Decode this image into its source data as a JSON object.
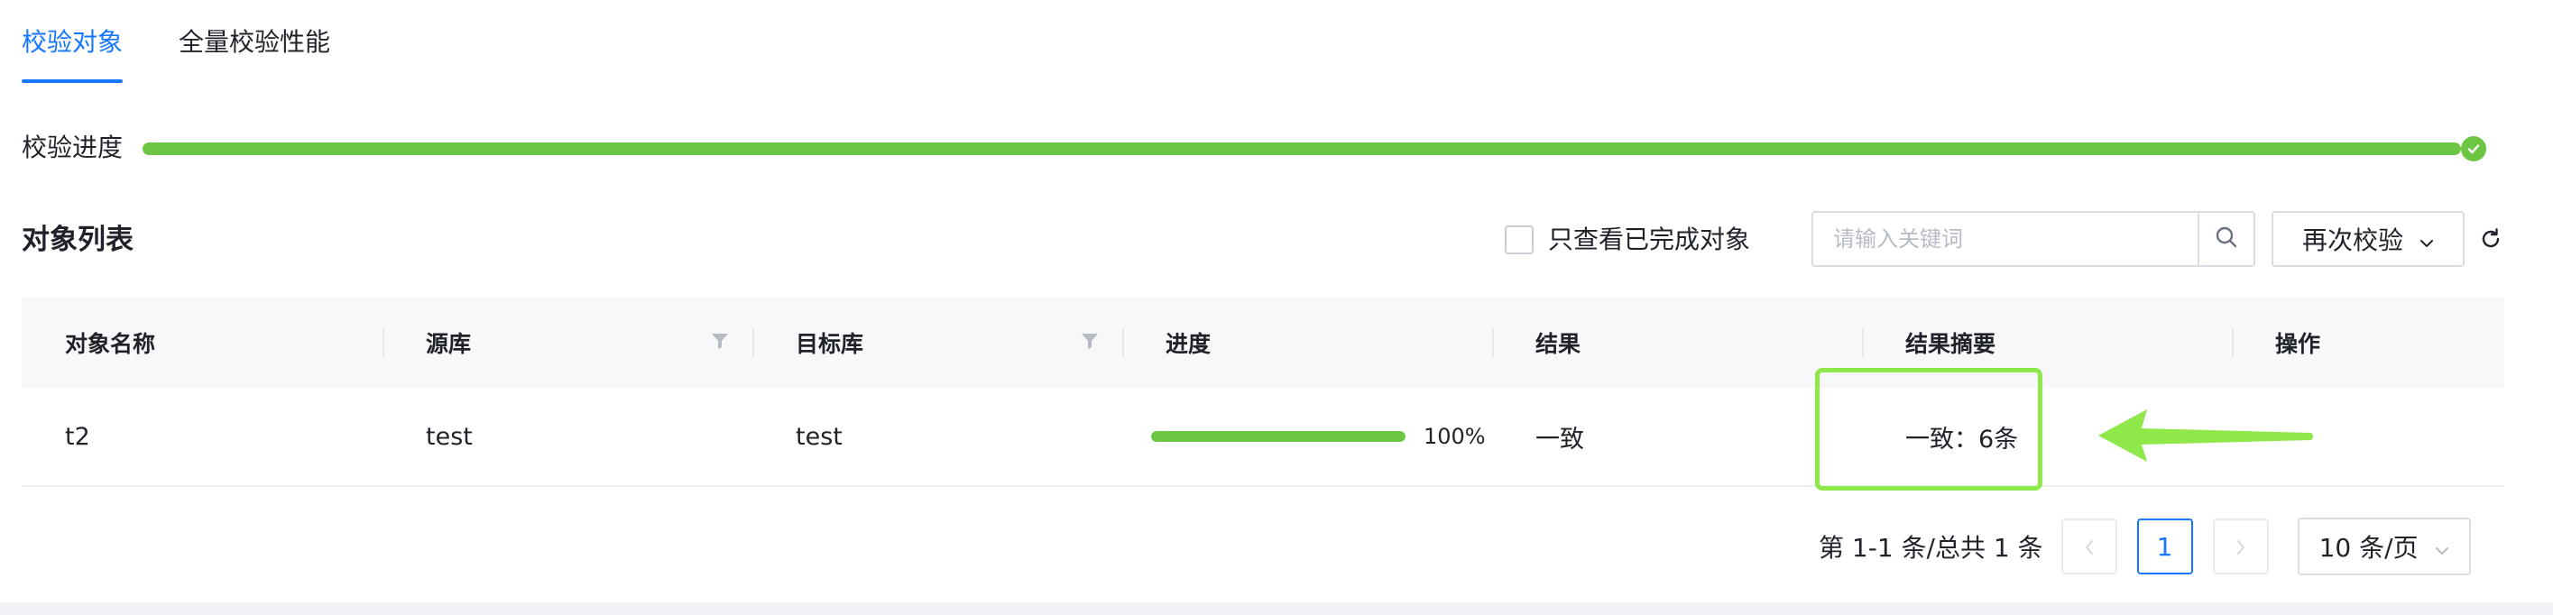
{
  "tabs": [
    {
      "label": "校验对象",
      "active": true
    },
    {
      "label": "全量校验性能",
      "active": false
    }
  ],
  "overall_progress": {
    "label": "校验进度",
    "value": 1.0,
    "status": "complete"
  },
  "list": {
    "title": "对象列表",
    "filter_checkbox_label": "只查看已完成对象",
    "filter_checked": false,
    "search_placeholder": "请输入关键词",
    "search_value": "",
    "recheck_button_label": "再次校验"
  },
  "table": {
    "columns": [
      "对象名称",
      "源库",
      "目标库",
      "进度",
      "结果",
      "结果摘要",
      "操作"
    ],
    "filterable_columns": [
      "源库",
      "目标库"
    ],
    "rows": [
      {
        "name": "t2",
        "source_db": "test",
        "target_db": "test",
        "progress": 1.0,
        "progress_text": "100%",
        "result": "一致",
        "summary": "一致：6条",
        "action": ""
      }
    ]
  },
  "pagination": {
    "total_text": "第 1-1 条/总共 1 条",
    "current_page": "1",
    "page_size_label": "10 条/页"
  },
  "colors": {
    "accent": "#1677ff",
    "progress": "#6cc644",
    "annotation": "#8ee84a"
  },
  "icons": {
    "search": "search-icon",
    "dropdown": "chevron-down-icon",
    "refresh": "refresh-icon",
    "filter": "filter-icon",
    "complete": "check-circle-icon"
  }
}
